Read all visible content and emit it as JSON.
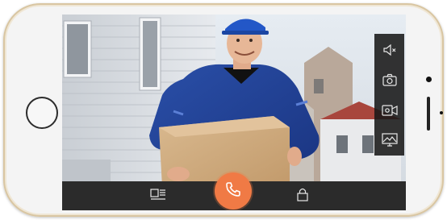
{
  "device": {
    "type": "smartphone-landscape"
  },
  "video_feed": {
    "description_icon": "delivery-person-video-icon"
  },
  "side_controls": [
    {
      "name": "mute-speaker",
      "icon": "speaker-mute-icon"
    },
    {
      "name": "snapshot",
      "icon": "camera-icon"
    },
    {
      "name": "record-video",
      "icon": "video-record-icon"
    },
    {
      "name": "gallery",
      "icon": "image-gallery-icon"
    }
  ],
  "bottom_bar": {
    "left_icon": "monitor-list-icon",
    "center_icon": "phone-handset-icon",
    "right_icon": "lock-icon"
  },
  "colors": {
    "accent": "#f07a45",
    "bar": "#2b2b2b",
    "panel": "#181818"
  }
}
